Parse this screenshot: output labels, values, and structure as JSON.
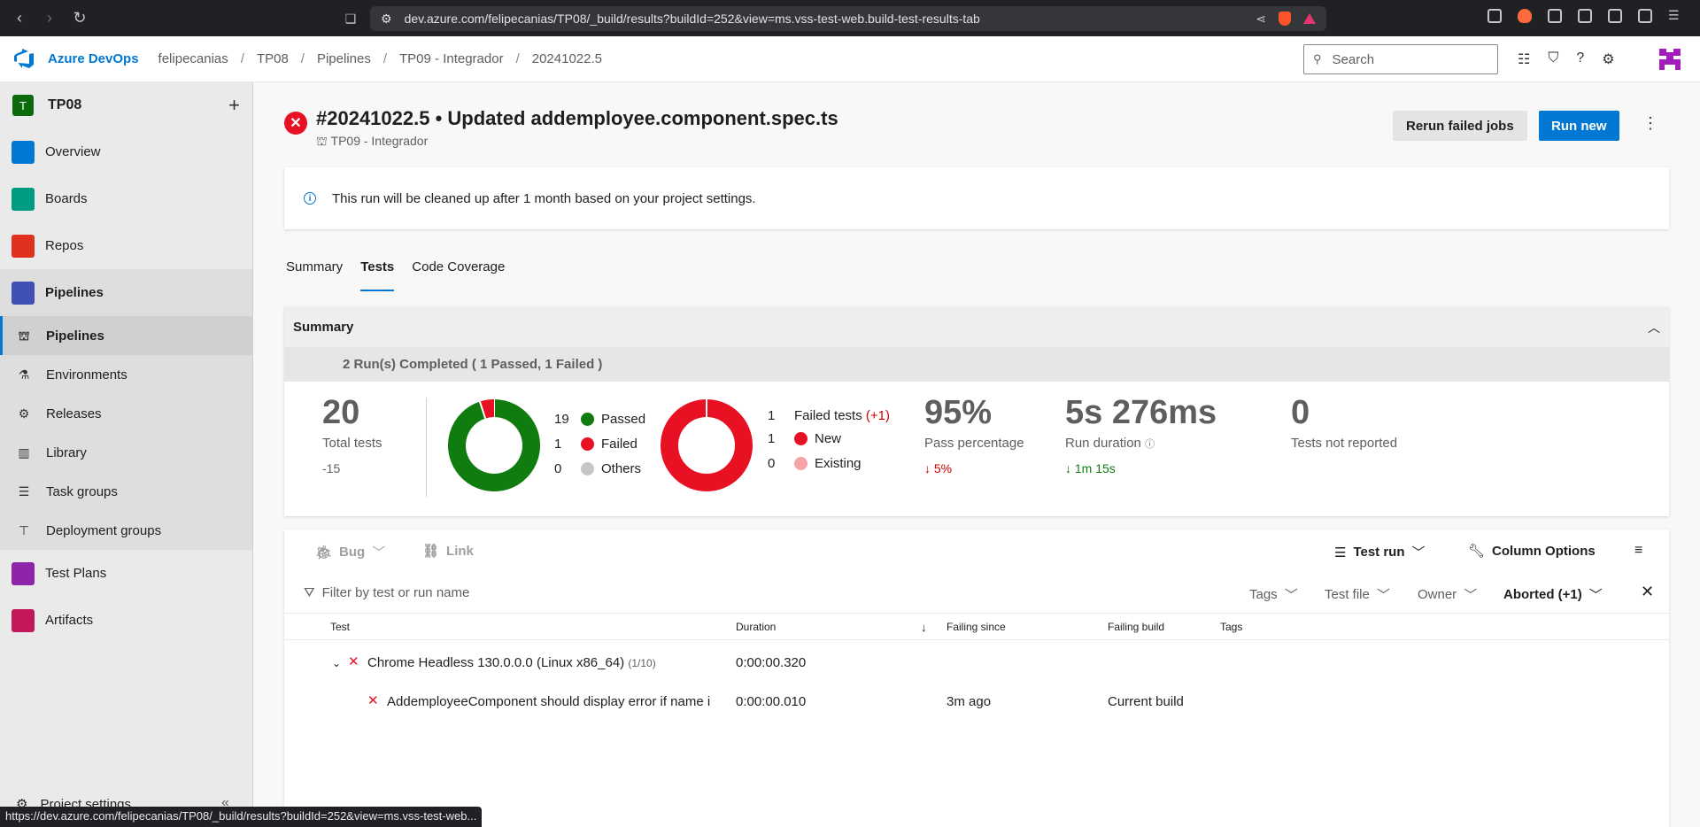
{
  "browser": {
    "url": "dev.azure.com/felipecanias/TP08/_build/results?buildId=252&view=ms.vss-test-web.build-test-results-tab",
    "status_url": "https://dev.azure.com/felipecanias/TP08/_build/results?buildId=252&view=ms.vss-test-web..."
  },
  "header": {
    "brand": "Azure DevOps",
    "breadcrumbs": [
      "felipecanias",
      "TP08",
      "Pipelines",
      "TP09 - Integrador",
      "20241022.5"
    ],
    "search_placeholder": "Search"
  },
  "sidebar": {
    "project_initial": "T",
    "project_name": "TP08",
    "items": [
      {
        "label": "Overview",
        "color": "#0078d4"
      },
      {
        "label": "Boards",
        "color": "#009c82"
      },
      {
        "label": "Repos",
        "color": "#e0301e"
      },
      {
        "label": "Pipelines",
        "color": "#3f51b5"
      }
    ],
    "sub_items": [
      {
        "label": "Pipelines",
        "icon": "pipeline-icon"
      },
      {
        "label": "Environments",
        "icon": "environment-icon"
      },
      {
        "label": "Releases",
        "icon": "release-icon"
      },
      {
        "label": "Library",
        "icon": "library-icon"
      },
      {
        "label": "Task groups",
        "icon": "task-groups-icon"
      },
      {
        "label": "Deployment groups",
        "icon": "deployment-groups-icon"
      }
    ],
    "items_after": [
      {
        "label": "Test Plans",
        "color": "#8e24aa"
      },
      {
        "label": "Artifacts",
        "color": "#c2185b"
      }
    ],
    "settings": "Project settings"
  },
  "run": {
    "title": "#20241022.5 • Updated addemployee.component.spec.ts",
    "pipeline": "TP09 - Integrador",
    "rerun_label": "Rerun failed jobs",
    "run_new_label": "Run new"
  },
  "banner": "This run will be cleaned up after 1 month based on your project settings.",
  "tabs": [
    "Summary",
    "Tests",
    "Code Coverage"
  ],
  "summary": {
    "heading": "Summary",
    "runs_text": "2 Run(s) Completed ( 1 Passed, 1 Failed )",
    "total_tests": "20",
    "total_label": "Total tests",
    "total_delta": "-15",
    "outcome_legend": [
      {
        "count": "19",
        "label": "Passed",
        "color": "#107c10",
        "value": 19
      },
      {
        "count": "1",
        "label": "Failed",
        "color": "#e81123",
        "value": 1
      },
      {
        "count": "0",
        "label": "Others",
        "color": "#c8c6c4",
        "value": 0
      }
    ],
    "failed_legend": [
      {
        "count": "1",
        "label": "Failed tests",
        "extra": "(+1)"
      },
      {
        "count": "1",
        "label": "New",
        "color": "#e81123",
        "value": 1
      },
      {
        "count": "0",
        "label": "Existing",
        "color": "#f4a4a8",
        "value": 0
      }
    ],
    "pass_pct": "95%",
    "pass_label": "Pass percentage",
    "pass_delta": "↓ 5%",
    "duration": "5s 276ms",
    "duration_label": "Run duration",
    "duration_delta": "↓ 1m 15s",
    "not_reported": "0",
    "not_reported_label": "Tests not reported"
  },
  "toolbar": {
    "bug": "Bug",
    "link": "Link",
    "test_run": "Test run",
    "column_options": "Column Options"
  },
  "filters": {
    "placeholder": "Filter by test or run name",
    "tags": "Tags",
    "test_file": "Test file",
    "owner": "Owner",
    "outcome": "Aborted (+1)"
  },
  "columns": [
    "Test",
    "Duration",
    "Failing since",
    "Failing build",
    "Tags"
  ],
  "rows": [
    {
      "name": "Chrome Headless 130.0.0.0 (Linux x86_64)",
      "count": "(1/10)",
      "duration": "0:00:00.320",
      "since": "",
      "build": ""
    },
    {
      "name": "AddemployeeComponent should display error if name i",
      "count": "",
      "duration": "0:00:00.010",
      "since": "3m ago",
      "build": "Current build"
    }
  ]
}
